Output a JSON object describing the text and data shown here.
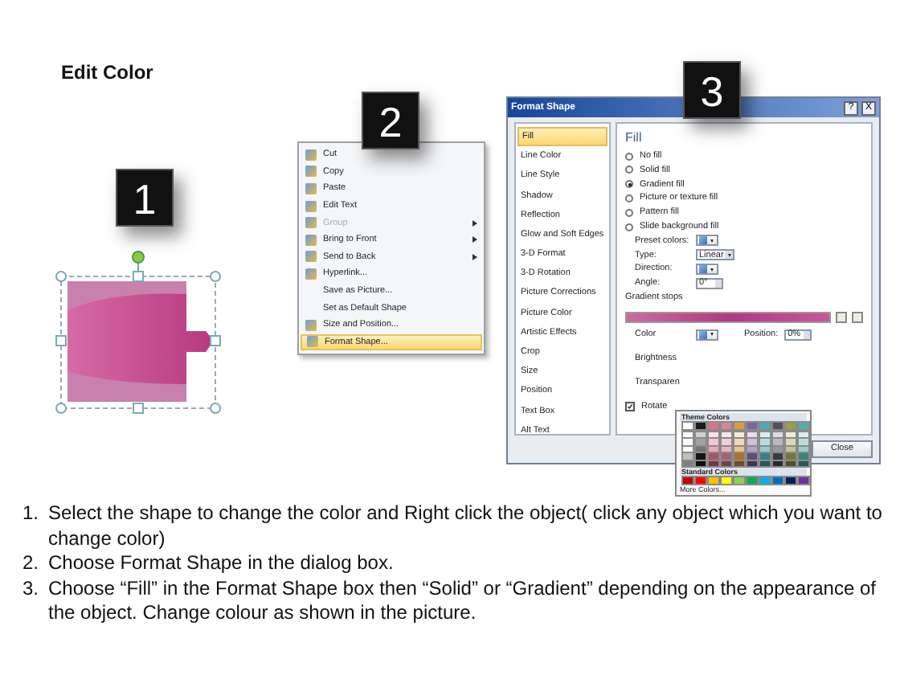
{
  "title": "Edit Color",
  "step_badges": [
    "1",
    "2",
    "3"
  ],
  "context_menu": {
    "items": [
      {
        "label": "Cut",
        "icon": true,
        "disabled": false,
        "submenu": false,
        "selected": false
      },
      {
        "label": "Copy",
        "icon": true,
        "disabled": false,
        "submenu": false,
        "selected": false
      },
      {
        "label": "Paste",
        "icon": true,
        "disabled": false,
        "submenu": false,
        "selected": false
      },
      {
        "label": "Edit Text",
        "icon": true,
        "disabled": false,
        "submenu": false,
        "selected": false
      },
      {
        "label": "Group",
        "icon": true,
        "disabled": true,
        "submenu": true,
        "selected": false
      },
      {
        "label": "Bring to Front",
        "icon": true,
        "disabled": false,
        "submenu": true,
        "selected": false
      },
      {
        "label": "Send to Back",
        "icon": true,
        "disabled": false,
        "submenu": true,
        "selected": false
      },
      {
        "label": "Hyperlink...",
        "icon": true,
        "disabled": false,
        "submenu": false,
        "selected": false
      },
      {
        "label": "Save as Picture...",
        "icon": false,
        "disabled": false,
        "submenu": false,
        "selected": false
      },
      {
        "label": "Set as Default Shape",
        "icon": false,
        "disabled": false,
        "submenu": false,
        "selected": false
      },
      {
        "label": "Size and Position...",
        "icon": true,
        "disabled": false,
        "submenu": false,
        "selected": false
      },
      {
        "label": "Format Shape...",
        "icon": true,
        "disabled": false,
        "submenu": false,
        "selected": true
      }
    ]
  },
  "dialog": {
    "title": "Format Shape",
    "title_buttons": [
      "?",
      "X"
    ],
    "sidebar": [
      {
        "label": "Fill",
        "selected": true
      },
      {
        "label": "Line Color",
        "selected": false
      },
      {
        "label": "Line Style",
        "selected": false
      },
      {
        "label": "Shadow",
        "selected": false
      },
      {
        "label": "Reflection",
        "selected": false
      },
      {
        "label": "Glow and Soft Edges",
        "selected": false
      },
      {
        "label": "3-D Format",
        "selected": false
      },
      {
        "label": "3-D Rotation",
        "selected": false
      },
      {
        "label": "Picture Corrections",
        "selected": false
      },
      {
        "label": "Picture Color",
        "selected": false
      },
      {
        "label": "Artistic Effects",
        "selected": false
      },
      {
        "label": "Crop",
        "selected": false
      },
      {
        "label": "Size",
        "selected": false
      },
      {
        "label": "Position",
        "selected": false
      },
      {
        "label": "Text Box",
        "selected": false
      },
      {
        "label": "Alt Text",
        "selected": false
      }
    ],
    "heading": "Fill",
    "fill_options": [
      {
        "label": "No fill",
        "selected": false
      },
      {
        "label": "Solid fill",
        "selected": false
      },
      {
        "label": "Gradient fill",
        "selected": true
      },
      {
        "label": "Picture or texture fill",
        "selected": false
      },
      {
        "label": "Pattern fill",
        "selected": false
      },
      {
        "label": "Slide background fill",
        "selected": false
      }
    ],
    "fields": [
      {
        "label": "Preset colors:",
        "kind": "swatch"
      },
      {
        "label": "Type:",
        "kind": "dropdown",
        "value": "Linear"
      },
      {
        "label": "Direction:",
        "kind": "swatch"
      },
      {
        "label": "Angle:",
        "kind": "spinner",
        "value": "0°"
      }
    ],
    "gradient_stops_label": "Gradient stops",
    "color_label": "Color",
    "position_label": "Position:",
    "position_value": "0%",
    "brightness_label": "Brightness",
    "transparency_label": "Transparen",
    "rotate": {
      "label": "Rotate",
      "checked": true
    },
    "close_button": "Close"
  },
  "palette": {
    "theme_header": "Theme Colors",
    "theme_colors": [
      {
        "color": "#ffffff"
      },
      {
        "color": "#1a1a1a"
      },
      {
        "color": "#e0708e"
      },
      {
        "color": "#d8849a"
      },
      {
        "color": "#e09a3c"
      },
      {
        "color": "#8064a2"
      },
      {
        "color": "#4aacb0"
      },
      {
        "color": "#4f4f5f"
      },
      {
        "color": "#9aa04a"
      },
      {
        "color": "#4fb0a8"
      }
    ],
    "standard_header": "Standard Colors",
    "standard_colors": [
      {
        "color": "#c00000"
      },
      {
        "color": "#ff0000"
      },
      {
        "color": "#ffc000"
      },
      {
        "color": "#ffff00"
      },
      {
        "color": "#92d050"
      },
      {
        "color": "#00b050"
      },
      {
        "color": "#00b0f0"
      },
      {
        "color": "#0070c0"
      },
      {
        "color": "#002060"
      },
      {
        "color": "#7030a0"
      }
    ],
    "more_colors": "More Colors..."
  },
  "steps": [
    {
      "number": "1.",
      "text": "Select the shape to change the color and Right click the object( click any object which you want to change color)"
    },
    {
      "number": "2.",
      "text": "Choose Format Shape in the dialog box."
    },
    {
      "number": "3.",
      "text": "Choose “Fill” in the Format Shape box then “Solid” or “Gradient” depending on the appearance of the object. Change colour as shown in the picture."
    }
  ]
}
